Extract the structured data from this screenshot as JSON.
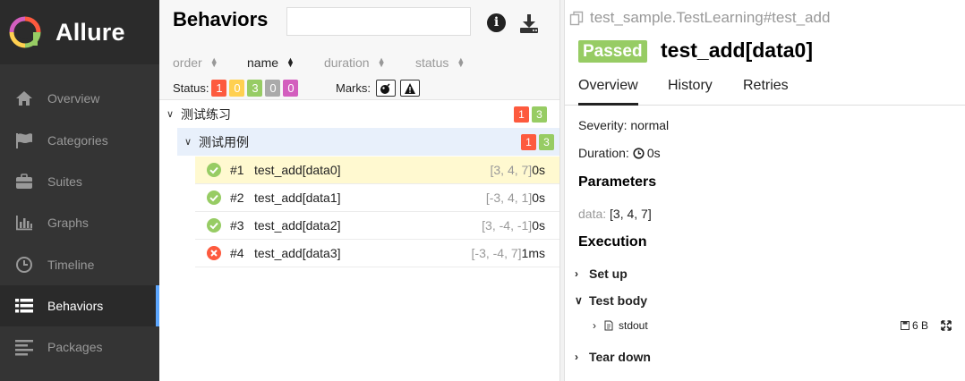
{
  "brand": {
    "name": "Allure"
  },
  "sidebar": {
    "items": [
      {
        "label": "Overview",
        "icon": "home-icon"
      },
      {
        "label": "Categories",
        "icon": "flag-icon"
      },
      {
        "label": "Suites",
        "icon": "briefcase-icon"
      },
      {
        "label": "Graphs",
        "icon": "bar-chart-icon"
      },
      {
        "label": "Timeline",
        "icon": "clock-icon"
      },
      {
        "label": "Behaviors",
        "icon": "list-icon",
        "active": true
      },
      {
        "label": "Packages",
        "icon": "align-left-icon"
      }
    ]
  },
  "behaviors": {
    "title": "Behaviors",
    "search_placeholder": "",
    "sort": [
      {
        "label": "order",
        "active": false
      },
      {
        "label": "name",
        "active": true
      },
      {
        "label": "duration",
        "active": false
      },
      {
        "label": "status",
        "active": false
      }
    ],
    "status_label": "Status:",
    "status_counts": {
      "failed": "1",
      "broken": "0",
      "passed": "3",
      "skipped": "0",
      "unknown": "0"
    },
    "marks_label": "Marks:",
    "groups": [
      {
        "name": "测试练习",
        "failed": "1",
        "passed": "3"
      },
      {
        "name": "测试用例",
        "failed": "1",
        "passed": "3"
      }
    ],
    "tests": [
      {
        "num": "#1",
        "name": "test_add[data0]",
        "params": "[3, 4, 7]",
        "duration": "0s",
        "status": "passed",
        "selected": true
      },
      {
        "num": "#2",
        "name": "test_add[data1]",
        "params": "[-3, 4, 1]",
        "duration": "0s",
        "status": "passed"
      },
      {
        "num": "#3",
        "name": "test_add[data2]",
        "params": "[3, -4, -1]",
        "duration": "0s",
        "status": "passed"
      },
      {
        "num": "#4",
        "name": "test_add[data3]",
        "params": "[-3, -4, 7]",
        "duration": "1ms",
        "status": "failed"
      }
    ]
  },
  "detail": {
    "full_name": "test_sample.TestLearning#test_add",
    "status": "Passed",
    "name": "test_add[data0]",
    "tabs": [
      "Overview",
      "History",
      "Retries"
    ],
    "severity_label": "Severity:",
    "severity": "normal",
    "duration_label": "Duration:",
    "duration": "0s",
    "parameters_title": "Parameters",
    "param_name": "data",
    "param_sep": ":",
    "param_value": "[3, 4, 7]",
    "execution_title": "Execution",
    "setup_label": "Set up",
    "body_label": "Test body",
    "attachment_name": "stdout",
    "attachment_size": "6 B",
    "teardown_label": "Tear down"
  },
  "colors": {
    "sidebar_bg": "#343434",
    "active_accent": "#5da7ff",
    "failed": "#fd5a3e",
    "broken": "#ffd050",
    "passed": "#97cc64",
    "skipped": "#aaaaaa",
    "unknown": "#d35ebe",
    "selected_row": "#fff9d0"
  }
}
